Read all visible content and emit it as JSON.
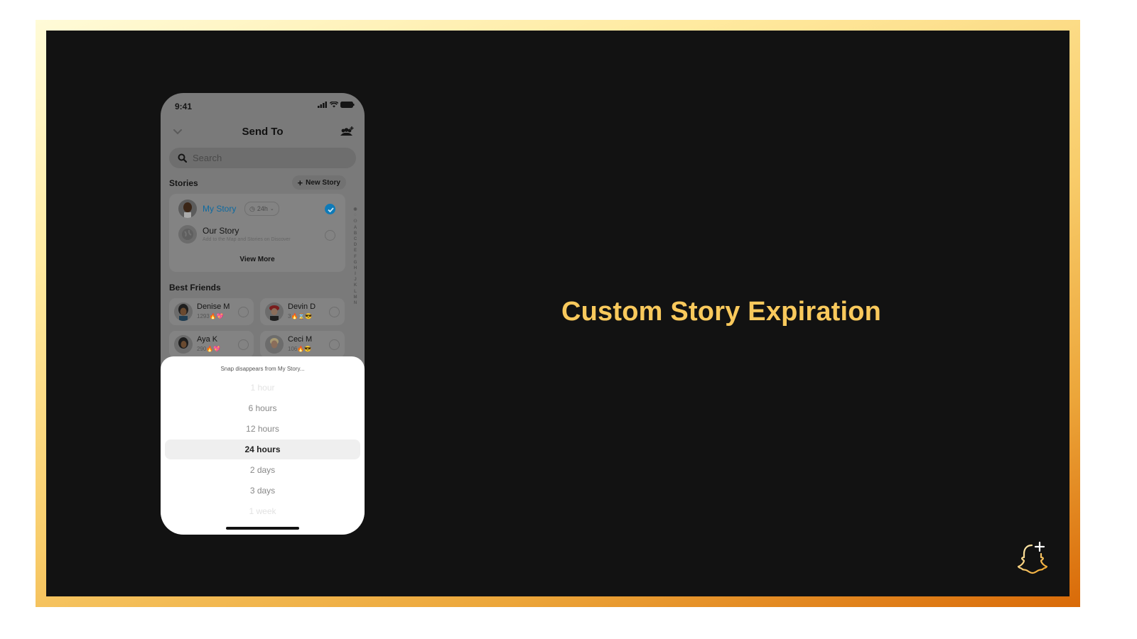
{
  "slide": {
    "headline": "Custom Story Expiration",
    "brand_icon": "snapchat-plus-ghost-icon",
    "colors": {
      "headline": "#f9c95c",
      "background": "#121212",
      "frame_gradient": [
        "#fffbd8",
        "#ffeaa0",
        "#f8cc6a",
        "#eca63a",
        "#d96a08"
      ]
    }
  },
  "phone": {
    "status_bar": {
      "time": "9:41",
      "icons": [
        "signal-icon",
        "wifi-icon",
        "battery-icon"
      ]
    },
    "header": {
      "title": "Send To",
      "back_icon": "chevron-down-icon",
      "action_icon": "add-friends-icon"
    },
    "search": {
      "placeholder": "Search"
    },
    "stories": {
      "label": "Stories",
      "new_story_label": "New Story",
      "items": [
        {
          "name": "My Story",
          "timer": "24h",
          "selected": true,
          "accent": "#0e7ab8"
        },
        {
          "name": "Our Story",
          "subtitle": "Add to the Map and Stories on Discover",
          "selected": false
        }
      ],
      "view_more": "View More"
    },
    "best_friends": {
      "label": "Best Friends",
      "items": [
        {
          "name": "Denise M",
          "streak": "1293🔥💖"
        },
        {
          "name": "Devin D",
          "streak": "3🔥⌛😎"
        },
        {
          "name": "Aya K",
          "streak": "290🔥💖"
        },
        {
          "name": "Ceci M",
          "streak": "106🔥😎"
        }
      ]
    },
    "alpha_index": [
      "◉",
      "◌",
      "⚇",
      "A",
      "B",
      "C",
      "D",
      "E",
      "F",
      "G",
      "H",
      "I",
      "J",
      "K",
      "L",
      "M",
      "N"
    ],
    "expiration_sheet": {
      "title": "Snap disappears from My Story...",
      "options": [
        {
          "label": "1 hour",
          "state": "faint"
        },
        {
          "label": "6 hours",
          "state": "normal"
        },
        {
          "label": "12 hours",
          "state": "normal"
        },
        {
          "label": "24 hours",
          "state": "selected"
        },
        {
          "label": "2 days",
          "state": "normal"
        },
        {
          "label": "3 days",
          "state": "normal"
        },
        {
          "label": "1 week",
          "state": "faint"
        }
      ]
    }
  }
}
